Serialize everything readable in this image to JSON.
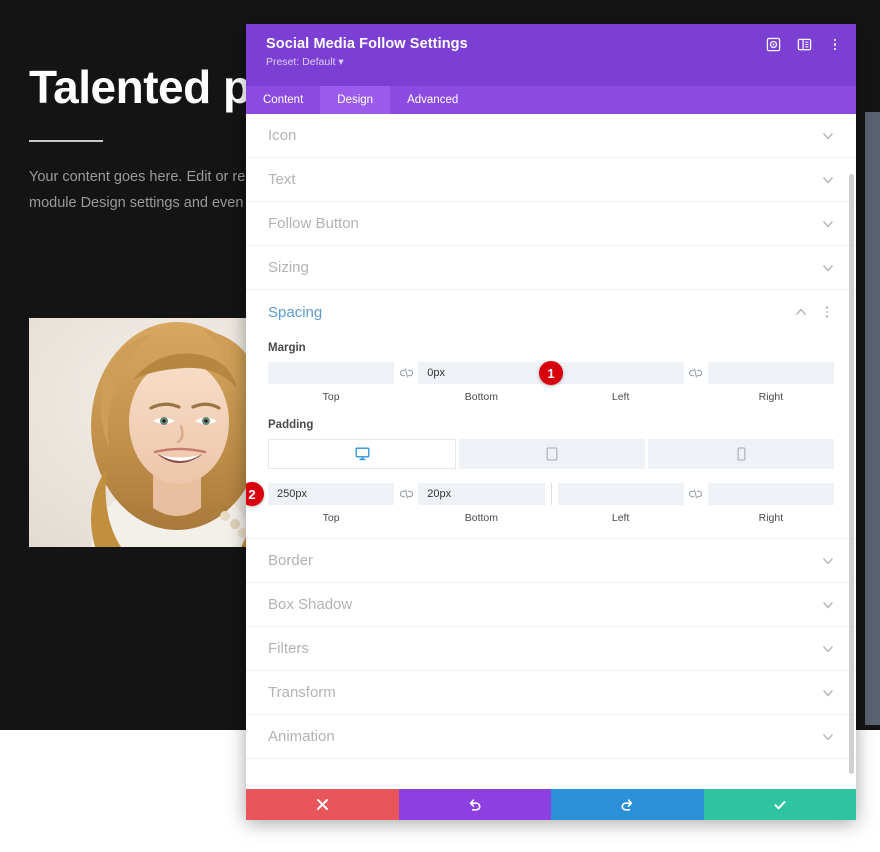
{
  "background": {
    "heading": "Talented peo",
    "body": "Your content goes here. Edit or remove\nmodule Design settings and even appl",
    "photo_alt": "portrait-photo"
  },
  "modal": {
    "title": "Social Media Follow Settings",
    "preset": "Preset: Default ▾",
    "header_icons": [
      {
        "name": "target-icon"
      },
      {
        "name": "layout-panel-icon"
      },
      {
        "name": "more-vertical-icon"
      }
    ],
    "tabs": [
      {
        "label": "Content",
        "active": false
      },
      {
        "label": "Design",
        "active": true
      },
      {
        "label": "Advanced",
        "active": false
      }
    ],
    "sections": [
      {
        "label": "Icon",
        "open": false
      },
      {
        "label": "Text",
        "open": false
      },
      {
        "label": "Follow Button",
        "open": false
      },
      {
        "label": "Sizing",
        "open": false
      },
      {
        "label": "Spacing",
        "open": true
      },
      {
        "label": "Border",
        "open": false
      },
      {
        "label": "Box Shadow",
        "open": false
      },
      {
        "label": "Filters",
        "open": false
      },
      {
        "label": "Transform",
        "open": false
      },
      {
        "label": "Animation",
        "open": false
      }
    ],
    "spacing": {
      "margin": {
        "label": "Margin",
        "fields": [
          {
            "sub": "Top",
            "value": "",
            "placeholder": ""
          },
          {
            "sub": "Bottom",
            "value": "0px",
            "placeholder": ""
          },
          {
            "sub": "Left",
            "value": "",
            "placeholder": ""
          },
          {
            "sub": "Right",
            "value": "",
            "placeholder": ""
          }
        ],
        "badge": "1"
      },
      "padding": {
        "label": "Padding",
        "devices": [
          {
            "name": "desktop-icon",
            "active": true
          },
          {
            "name": "tablet-icon",
            "active": false
          },
          {
            "name": "phone-icon",
            "active": false
          }
        ],
        "fields": [
          {
            "sub": "Top",
            "value": "250px",
            "placeholder": ""
          },
          {
            "sub": "Bottom",
            "value": "20px",
            "placeholder": ""
          },
          {
            "sub": "Left",
            "value": "",
            "placeholder": ""
          },
          {
            "sub": "Right",
            "value": "",
            "placeholder": ""
          }
        ],
        "badge": "2"
      }
    },
    "footer": [
      {
        "name": "cancel-button",
        "icon": "close-icon"
      },
      {
        "name": "undo-button",
        "icon": "undo-icon"
      },
      {
        "name": "redo-button",
        "icon": "redo-icon"
      },
      {
        "name": "save-button",
        "icon": "check-icon"
      }
    ]
  },
  "colors": {
    "header_purple": "#7b3fd4",
    "tab_purple": "#8b4ae0",
    "tab_active_purple": "#9c5ceb",
    "badge_red": "#d8000c",
    "cancel_red": "#e8555a",
    "undo_purple": "#8e3fe0",
    "redo_blue": "#2a91d8",
    "save_green": "#2ec4a0",
    "open_section_blue": "#5b9ad1"
  }
}
